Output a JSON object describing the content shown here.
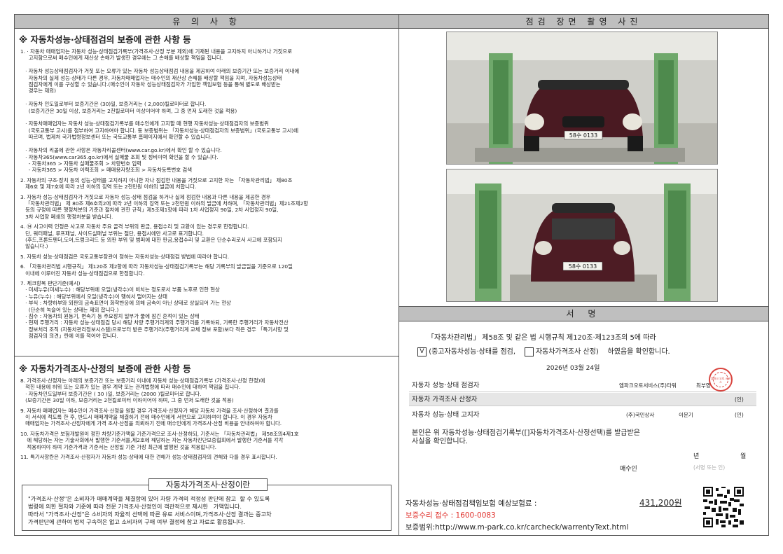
{
  "notice": {
    "header": "유 의 사 항",
    "section1_title": "※  자동차성능·상태점검의 보증에 관한 사항 등",
    "section1_items": [
      "1. · 자동차 매매업자는 자동차 성능·상태점검기록부(가격조사·산정 부분 제외)에 기재된 내용을 고지하지 아니하거나 거짓으로\n     고지함으로써 매수인에게 재산상 손해가 발생한 경우에는 그 손해를 배상할 책임을 집니다.\n\n   · 자동차 성능상태점검자가 거짓 또는 오류가 있는 자동차 성능상태점검 내용을 제공하여 아래의 보증기간 또는 보증거리 이내에\n     자동차의 실제 성능·상태가 다른 경우, 자동차매매업자는 매수인의 재산상 손해를 배상할 책임을 지며, 자동차성능상태\n     점검자에게 이를 구상할 수 있습니다.(매수인이 자동차 성능상태점검자가 가입한 책임보험 등을 통해 별도로 배상받는\n     경우는 제외)\n\n   · 자동차 인도일로부터 보증기간은 (30)일, 보증거리는 ( 2,000)킬로미터로 합니다.\n     (보증기간은 30일 이상, 보증거리는 2천킬로미터 이상이어야 하며, 그 중 먼저 도래한 것을 적용)\n\n   · 자동차매매업자는 자동차 성능·상태점검기록부를 매수인에게 고지할 때 현행 자동차성능·상태점검자의 보증범위\n     (국토교통부 고시)를 첨부하여 고지하여야 합니다. 동 보증범위는 「자동차성능·상태점검자의 보증범위」(국토교통부 고시)에\n     따르며, 법제처 국가법령정보센터 또는 국토교통부 홈페이지에서 확인할 수 있습니다.\n\n   · 자동차의 리콜에 관한 사항은 자동차리콜센터(www.car.go.kr)에서 확인 할 수 있습니다.\n   · 자동차365(www.car365.go.kr)에서 실매물 조회 및 정비이력 확인을 할 수 있습니다.\n     - 자동차365 > 자동차 실매물조회 > 차량번호 입력\n     - 자동차365 > 자동차 이력조회 > 매매용자량조회 > 자동차등록번호 검색",
      "2. 자동차의 구조·장치 등의 성능·상태를 고지하지 아니한 자나 점검한 내용을 거짓으로 고지한 자는 「자동차관리법」 제80조\n   제6호 및 제7호에 따라 2년 이하의 징역 또는 2천만원 이하의 벌금에 처합니다.",
      "3. 자동차 성능·상태점검자가 거짓으로 자동차 성능·상태 점검을 하거나 실제 점검한 내용과 다른 내용을 제공한 경우\n   「자동차관리법」 제 80조 제6호의2에 따라 2년 이하의 징역 또는 2천만원 이하의 벌금에 처하며, 「자동차관리법」제21조제2항\n   등의 규정에 따른 행정처분의 기준과 절차에 관한 규칙」제5조제1항에 따라 1차 사업정지 90일, 2차 사업정지 90일,\n   3차 사업장 폐쇄의 행정처분을 받습니다.",
      "4. ⑭ 사고이력 인정은 사고로 자동차 주요 골격 부위의 판금, 용접수리 및 교환이 있는 경우로 한정합니다.\n   단, 쿼터패널, 루프패널, 사이드실패널 부위는 절단, 용접시에만 사고로 표기합니다.\n   (후드,프론트펜더,도어,트렁크리드 등 외판 부위 및 범퍼에 대한 판금,용접수리 및 교환은 단순수리로서 사고에 포함되지\n   않습니다.)",
      "5. 자동차 성능·상태점검은 국토교통부장관이 정하는 자동차성능·상태점검 방법에 따라야 합니다.",
      "6. 「자동차관리법 시행규칙」 제120조 제2항에 따라 자동차성능·상태점검기록부는 해당 기록부의 발급일을 기준으로 120일\n   이내에 이루어진 자동차 성능·상태점검으로 한정합니다.",
      "7. 체크항목 판단기준(예시)\n   · 미세누유(미세누수) : 해당부위에 오일(냉각수)이 비치는 정도로서 부품 노후로 인한 현상\n   · 누유(누수) : 해당부위에서 오일(냉각수)이 맺혀서 떨어지는 상태\n   · 부식 : 차량하부와 외판의 금속표면이 화학반응에 의해 금속이 아닌 상태로 상실되어 가는 현상\n     (단순히 녹슬어 있는 상태는 제외 합니다.)\n   · 침수 : 자동차의 원동기, 변속기 등 주요장치 일부가 물에 잠긴 흔적이 있는 상태\n   · 현재 주행거리 : 자동차 성능·상태점검 당시 해당 차량 주행거리계의 주행거리를 기록하되, 기록한 주행거리가 자동차전산\n     정보처리 조직 (자동차관리정보시스템)으로부터 받은 주행거리(주행거리계 교체 정보 포함)보다 적은 경우 「특기사항 및\n     점검자의 의견」란에 이를 적어야 합니다."
    ],
    "section2_title": "※  자동차가격조사·산정의 보증에 관한 사항 등",
    "section2_items": [
      "8. 가격조사·산정자는 아래의 보증기간 또는 보증거리 이내에 자동차 성능·상태점검기록부 (가격조사·산정 한정)에\n   적힌 내용에 허위 또는 오류가 있는 경우 계약 또는 관계법령에 따라 매수인에 대하여 책임을 집니다.\n   · 자동차인도일부터 보증기간은 ( 30 )일, 보증거리는 (2000 )킬로미터로 합니다.\n   (보증기간은 30일 이하, 보증거리는 2천킬로미터 이하이어야 하며, 그 중 먼저 도래한 것을 적용)",
      "9. 자동차 매매업자는 매수인이 가격조사·산정을 원할 경우 가격조사·산정자가 해당 자동차 가격을 조사·산정하여 결과를\n   이 서식에 적도록 한 후, 반드시 매매계약을 체결하기 전에 매수인에게 서면으로 고지하여야 합니다. 이 경우 자동차\n   매매업자는 가격조사·산정자에게 가격 조사·산정을 의뢰하기 전에 매수인에게 가격조사·산정 비용을 안내하여야 합니다.",
      "10. 자동차가격은 보험개발원이 정한 차량기준가액을 기준가격으로 조사·산정하되, 기준서는 「자동차관리법」 제58조의4제1호\n    에 해당하는 자는 기술사회에서 발행한 기준서를,제2호에 해당하는 자는 자동차진단보증협회에서 발행한 기준서를 각각\n    적용하여야 하며 기준가격과 기준서는 산정일 기준 가장 최근에 발행된 것을 적용합니다.",
      "11. 특기사항란은 가격조사·산정자가 자동차 성능·상태에 대한 견해가 성능·상태점검자의 견해와 다를 경우 표시합니다."
    ],
    "definition_title": "자동차가격조사·산정이란",
    "definition_text": "\"가격조사·산정\"은 소비자가 매매계약을 체결함에 있어 차량 가격의 적정성 판단에 참고  할 수 있도록\n법령에 의한 절차와 기준에 따라 전문 가격조사·산정인이 객관적으로 제시한   가액입니다.\n따라서 \"가격조사·산정\"은 소비자의 자율적 선택에 따른 유료 서비스이며,가격조사·산정 결과는 중고차\n가격판단에 관하여 법적 구속력은 없고 소비자의 구매 여부 결정에 참고 자료로 활용됩니다."
  },
  "photos": {
    "header": "점검 장면 촬영 사진",
    "plate": "58수 0133"
  },
  "signature": {
    "header": "서 명",
    "line1": "「자동차관리법」 제58조 및 같은 법 시행규칙 제120조·제123조의 5에 따라",
    "check1_mark": "V",
    "check1_label": "(중고자동차성능·상태를 점검,",
    "check2_label": "자동차가격조사 산정)",
    "confirm": "하였음을 확인합니다.",
    "date": "2026년  03월  24일",
    "inspector_label": "자동차 성능·상태 점검자",
    "inspector_company": "엠파크오토서비스(주)타워",
    "inspector_name": "최부영",
    "stamp_text": "엠파크 오토 서비스",
    "appraiser_label": "자동차 가격조사 산정자",
    "seal": "(인)",
    "notifier_label": "자동차 성능·상태 고지자",
    "notifier_company": "(주)국민상사",
    "notifier_name": "이문기",
    "receipt_text": "본인은 위 자동차성능·상태점검기록부([]자동차가격조사·산정선택)를 발급받은\n사실을 확인합니다.",
    "year_label": "년",
    "month_label": "월",
    "buyer_label": "매수인",
    "buyer_sign": "(서명 또는 인)",
    "insurance_label": "자동차성능·상태점검책임보험  예상보험료 :",
    "insurance_amount": "431,200원",
    "repair_label": "보증수리 접수 :  1600-0083",
    "scope_label": "보증범위:http://www.m-park.co.kr/carcheck/warrentyText.html"
  }
}
